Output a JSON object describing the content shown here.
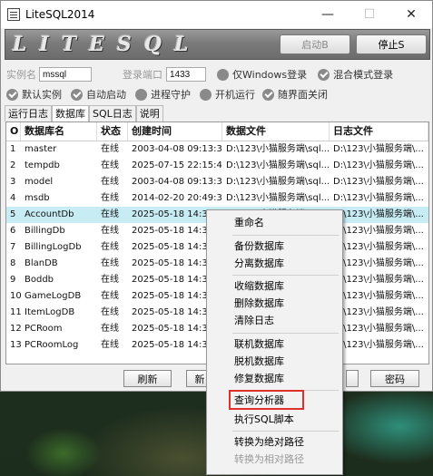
{
  "window": {
    "title": "LiteSQL2014",
    "minimize": "—",
    "maximize": "☐",
    "close": "✕"
  },
  "banner": {
    "logo": "LITESQL",
    "start_label": "启动B",
    "stop_label": "停止S"
  },
  "settings": {
    "instance_label": "实例名",
    "instance_value": "mssql",
    "port_label": "登录端口",
    "port_value": "1433",
    "windows_login": "仅Windows登录",
    "mixed_login": "混合模式登录",
    "default_instance": "默认实例",
    "auto_start": "自动启动",
    "process_guard": "进程守护",
    "boot_run": "开机运行",
    "close_with_ui": "随界面关闭"
  },
  "tabs": [
    "运行日志",
    "数据库",
    "SQL日志",
    "说明"
  ],
  "table": {
    "headers": [
      "O",
      "数据库名",
      "状态",
      "创建时间",
      "数据文件",
      "日志文件"
    ],
    "rows": [
      [
        "1",
        "master",
        "在线",
        "2003-04-08 09:13:36",
        "D:\\123\\小猫服务端\\sql...",
        "D:\\123\\小猫服务端\\..."
      ],
      [
        "2",
        "tempdb",
        "在线",
        "2025-07-15 22:15:40",
        "D:\\123\\小猫服务端\\sql...",
        "D:\\123\\小猫服务端\\..."
      ],
      [
        "3",
        "model",
        "在线",
        "2003-04-08 09:13:36",
        "D:\\123\\小猫服务端\\sql...",
        "D:\\123\\小猫服务端\\..."
      ],
      [
        "4",
        "msdb",
        "在线",
        "2014-02-20 20:49:38",
        "D:\\123\\小猫服务端\\sql...",
        "D:\\123\\小猫服务端\\..."
      ],
      [
        "5",
        "AccountDb",
        "在线",
        "2025-05-18 14:30:07",
        "D:\\123\\小猫服务端\\sql...",
        "D:\\123\\小猫服务端\\..."
      ],
      [
        "6",
        "BillingDb",
        "在线",
        "2025-05-18 14:30:",
        "",
        "D:\\123\\小猫服务端\\..."
      ],
      [
        "7",
        "BillingLogDb",
        "在线",
        "2025-05-18 14:30:",
        "",
        "D:\\123\\小猫服务端\\..."
      ],
      [
        "8",
        "BlanDB",
        "在线",
        "2025-05-18 14:30:",
        "",
        "D:\\123\\小猫服务端\\..."
      ],
      [
        "9",
        "Boddb",
        "在线",
        "2025-05-18 14:30:",
        "",
        "D:\\123\\小猫服务端\\..."
      ],
      [
        "10",
        "GameLogDB",
        "在线",
        "2025-05-18 14:30:",
        "",
        "D:\\123\\小猫服务端\\..."
      ],
      [
        "11",
        "ItemLogDB",
        "在线",
        "2025-05-18 14:30:",
        "",
        "D:\\123\\小猫服务端\\..."
      ],
      [
        "12",
        "PCRoom",
        "在线",
        "2025-05-18 14:30:",
        "",
        "D:\\123\\小猫服务端\\..."
      ],
      [
        "13",
        "PCRoomLog",
        "在线",
        "2025-05-18 14:30:",
        "",
        "D:\\123\\小猫服务端\\..."
      ]
    ]
  },
  "buttons": {
    "refresh": "刷新",
    "new_partial": "新",
    "password": "密码"
  },
  "context_menu": {
    "rename": "重命名",
    "backup": "备份数据库",
    "split": "分离数据库",
    "shrink": "收缩数据库",
    "delete": "删除数据库",
    "clear_log": "清除日志",
    "attach": "联机数据库",
    "detach": "脱机数据库",
    "repair": "修复数据库",
    "query_analyzer": "查询分析器",
    "run_script": "执行SQL脚本",
    "to_absolute": "转换为绝对路径",
    "to_relative": "转换为相对路径"
  },
  "colors": {
    "selected_row": "#c8ecf4",
    "highlight_box": "#e0302a"
  }
}
